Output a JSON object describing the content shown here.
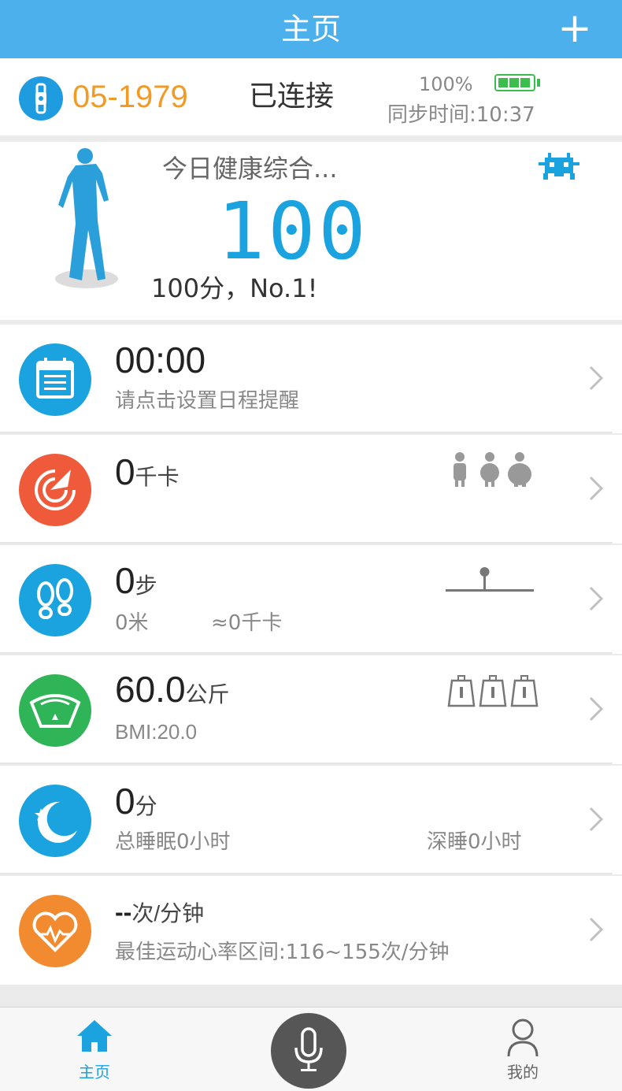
{
  "header": {
    "title": "主页",
    "add_label": "+"
  },
  "device": {
    "id": "05-1979",
    "status": "已连接",
    "battery": "100%",
    "sync": "同步时间:10:37"
  },
  "health": {
    "title": "今日健康综合...",
    "score": "100",
    "subtitle": "100分，No.1!"
  },
  "rows": {
    "schedule": {
      "value": "00:00",
      "hint": "请点击设置日程提醒"
    },
    "calories": {
      "value": "0",
      "unit": "千卡"
    },
    "steps": {
      "value": "0",
      "unit": "步",
      "distance": "0米",
      "kcal": "≈0千卡"
    },
    "weight": {
      "value": "60.0",
      "unit": "公斤",
      "bmi": "BMI:20.0"
    },
    "sleep": {
      "value": "0",
      "unit": "分",
      "total": "总睡眠0小时",
      "deep": "深睡0小时"
    },
    "heart": {
      "value": "--",
      "unit": "次/分钟",
      "range": "最佳运动心率区间:116~155次/分钟"
    }
  },
  "tabs": {
    "home": "主页",
    "me": "我的"
  },
  "colors": {
    "header": "#4cb0ec",
    "device_id": "#f19a24",
    "score": "#1aa3df",
    "calendar": "#1aa3df",
    "calories": "#ef5b3a",
    "steps": "#1aa3df",
    "weight": "#2fb457",
    "sleep": "#1aa3df",
    "heart": "#f28a30"
  }
}
